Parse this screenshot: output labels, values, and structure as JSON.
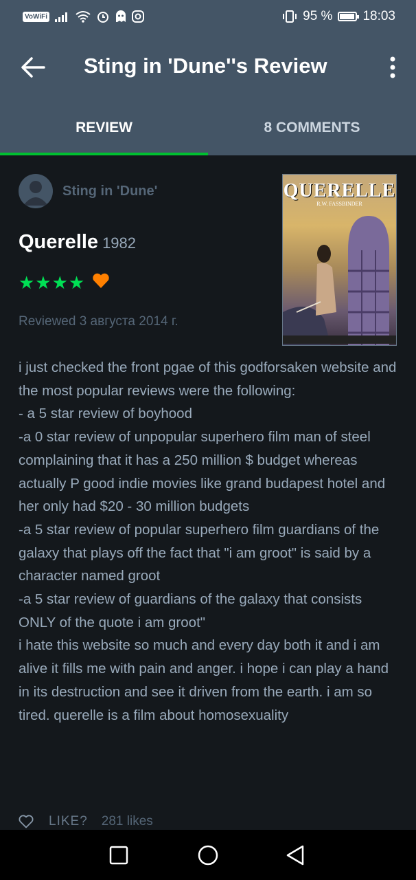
{
  "status_bar": {
    "network_label": "VoWiFi",
    "battery_text": "95 %",
    "battery_level": 0.95,
    "time": "18:03",
    "icons": [
      "signal-icon",
      "wifi-icon",
      "alarm-icon",
      "ghost-icon",
      "instagram-icon",
      "vibrate-icon",
      "battery-icon"
    ]
  },
  "app_bar": {
    "title": "Sting in 'Dune''s Review",
    "back_icon": "arrow-left-icon",
    "menu_icon": "more-vertical-icon"
  },
  "tabs": [
    {
      "label": "REVIEW",
      "active": true
    },
    {
      "label": "8 COMMENTS",
      "active": false
    }
  ],
  "review": {
    "reviewer": "Sting in 'Dune'",
    "film_title": "Querelle",
    "film_year": "1982",
    "rating": 4,
    "rating_stars": "★★★★",
    "liked": true,
    "reviewed_date": "Reviewed 3 августа 2014 г.",
    "poster": {
      "title": "QUERELLE",
      "credit": "R.W. FASSBINDER"
    },
    "body_lines": [
      "i just checked the front pgae of this godforsaken website and the most popular reviews were the following:",
      "- a 5 star review of boyhood",
      "-a 0 star review of unpopular superhero film man of steel complaining that it has a 250 million $ budget whereas actually P good indie movies like grand budapest hotel and her only had $20 - 30 million budgets",
      "-a 5 star review of popular superhero film guardians of the galaxy that plays off the fact that \"i am groot\" is said by a character named groot",
      "-a 5 star review of guardians of the galaxy that consists ONLY of the quote i am groot\"",
      "i hate this website so much and every day both it and i am alive it fills me with pain and anger. i hope i can play a hand in its destruction and see it driven from the earth. i am so tired. querelle is a film about homosexuality"
    ],
    "like_label": "LIKE?",
    "likes_count": "281 likes"
  },
  "colors": {
    "bar": "#445566",
    "background": "#14181c",
    "accent_green": "#00e054",
    "tab_indicator": "#00c030",
    "heart_orange": "#ff8000"
  }
}
